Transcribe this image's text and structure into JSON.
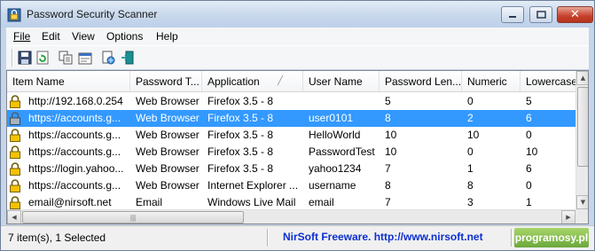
{
  "window": {
    "title": "Password Security Scanner"
  },
  "menu": [
    "File",
    "Edit",
    "View",
    "Options",
    "Help"
  ],
  "toolbar": {
    "buttons": [
      "save-icon",
      "refresh-icon",
      "copy-icon",
      "properties-icon",
      "html-report-icon",
      "exit-icon"
    ]
  },
  "table": {
    "columns": [
      "Item Name",
      "Password T...",
      "Application",
      "User Name",
      "Password Len...",
      "Numeric",
      "Lowercase"
    ],
    "sorted_column": "Application",
    "rows": [
      {
        "item_name": "http://192.168.0.254",
        "password_type": "Web Browser",
        "application": "Firefox 3.5 - 8",
        "user_name": "",
        "password_length": "5",
        "numeric": "0",
        "lowercase": "5",
        "selected": false
      },
      {
        "item_name": "https://accounts.g...",
        "password_type": "Web Browser",
        "application": "Firefox 3.5 - 8",
        "user_name": "user0101",
        "password_length": "8",
        "numeric": "2",
        "lowercase": "6",
        "selected": true
      },
      {
        "item_name": "https://accounts.g...",
        "password_type": "Web Browser",
        "application": "Firefox 3.5 - 8",
        "user_name": "HelloWorld",
        "password_length": "10",
        "numeric": "10",
        "lowercase": "0",
        "selected": false
      },
      {
        "item_name": "https://accounts.g...",
        "password_type": "Web Browser",
        "application": "Firefox 3.5 - 8",
        "user_name": "PasswordTest",
        "password_length": "10",
        "numeric": "0",
        "lowercase": "10",
        "selected": false
      },
      {
        "item_name": "https://login.yahoo...",
        "password_type": "Web Browser",
        "application": "Firefox 3.5 - 8",
        "user_name": "yahoo1234",
        "password_length": "7",
        "numeric": "1",
        "lowercase": "6",
        "selected": false
      },
      {
        "item_name": "https://accounts.g...",
        "password_type": "Web Browser",
        "application": "Internet Explorer ...",
        "user_name": "username",
        "password_length": "8",
        "numeric": "8",
        "lowercase": "0",
        "selected": false
      },
      {
        "item_name": "email@nirsoft.net",
        "password_type": "Email",
        "application": "Windows Live Mail",
        "user_name": "email",
        "password_length": "7",
        "numeric": "3",
        "lowercase": "1",
        "selected": false
      }
    ]
  },
  "status": {
    "count_text": "7 item(s), 1 Selected",
    "link_text": "NirSoft Freeware.  http://www.nirsoft.net",
    "watermark": "programosy.pl"
  },
  "colors": {
    "selection": "#3399ff",
    "link": "#0d2fd0",
    "lock_gold": "#e8b400"
  }
}
